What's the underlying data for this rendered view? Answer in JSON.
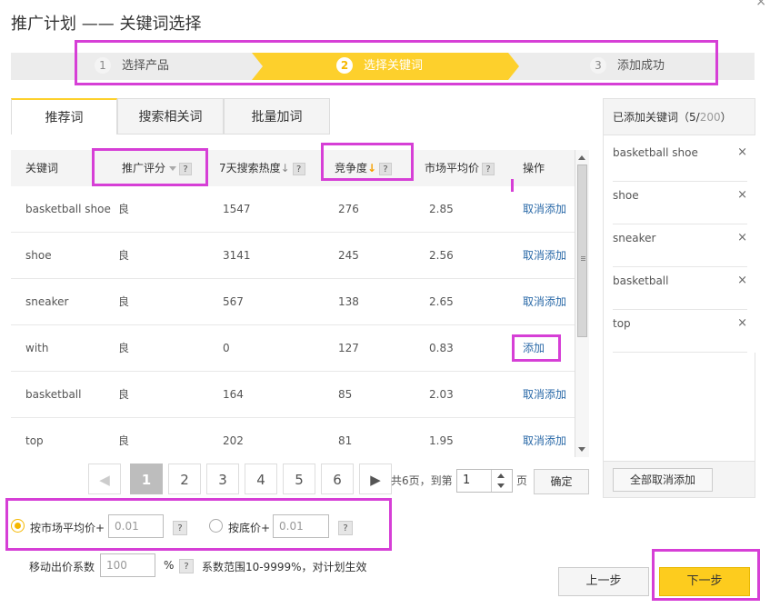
{
  "page": {
    "title": "推广计划 —— 关键词选择",
    "close": "×"
  },
  "steps": [
    {
      "num": "1",
      "label": "选择产品"
    },
    {
      "num": "2",
      "label": "选择关键词"
    },
    {
      "num": "3",
      "label": "添加成功"
    }
  ],
  "tabs": [
    {
      "label": "推荐词"
    },
    {
      "label": "搜索相关词"
    },
    {
      "label": "批量加词"
    }
  ],
  "table": {
    "headers": {
      "keyword": "关键词",
      "score": "推广评分",
      "heat": "7天搜索热度",
      "heat_arrow": "↓",
      "competition": "竞争度",
      "competition_arrow": "↓",
      "avg_price": "市场平均价",
      "action": "操作",
      "help": "?"
    },
    "rows": [
      {
        "keyword": "basketball shoe",
        "score": "良",
        "heat": "1547",
        "competition": "276",
        "price": "2.85",
        "action": "取消添加"
      },
      {
        "keyword": "shoe",
        "score": "良",
        "heat": "3141",
        "competition": "245",
        "price": "2.56",
        "action": "取消添加"
      },
      {
        "keyword": "sneaker",
        "score": "良",
        "heat": "567",
        "competition": "138",
        "price": "2.65",
        "action": "取消添加"
      },
      {
        "keyword": "with",
        "score": "良",
        "heat": "0",
        "competition": "127",
        "price": "0.83",
        "action": "添加"
      },
      {
        "keyword": "basketball",
        "score": "良",
        "heat": "164",
        "competition": "85",
        "price": "2.03",
        "action": "取消添加"
      },
      {
        "keyword": "top",
        "score": "良",
        "heat": "202",
        "competition": "81",
        "price": "1.95",
        "action": "取消添加"
      }
    ]
  },
  "pagination": {
    "pages": [
      "1",
      "2",
      "3",
      "4",
      "5",
      "6"
    ],
    "current": "1",
    "info": "共6页，到第",
    "goto_value": "1",
    "unit": "页",
    "confirm": "确定"
  },
  "pricing": {
    "option1_label": "按市场平均价+",
    "option1_value": "0.01",
    "option2_label": "按底价+",
    "option2_value": "0.01",
    "help": "?",
    "mobile_label": "移动出价系数",
    "mobile_value": "100",
    "percent": "%",
    "range_text": "系数范围10-9999%，对计划生效"
  },
  "buttons": {
    "prev": "上一步",
    "next": "下一步"
  },
  "side": {
    "title_prefix": "已添加关键词（",
    "count": "5",
    "sep": "/",
    "max": "200",
    "title_suffix": "）",
    "items": [
      {
        "label": "basketball shoe"
      },
      {
        "label": "shoe"
      },
      {
        "label": "sneaker"
      },
      {
        "label": "basketball"
      },
      {
        "label": "top"
      }
    ],
    "remove": "×",
    "clear_all": "全部取消添加"
  },
  "colors": {
    "accent": "#fdd02c",
    "link": "#2b6aa8",
    "highlight": "#d63fd6"
  }
}
